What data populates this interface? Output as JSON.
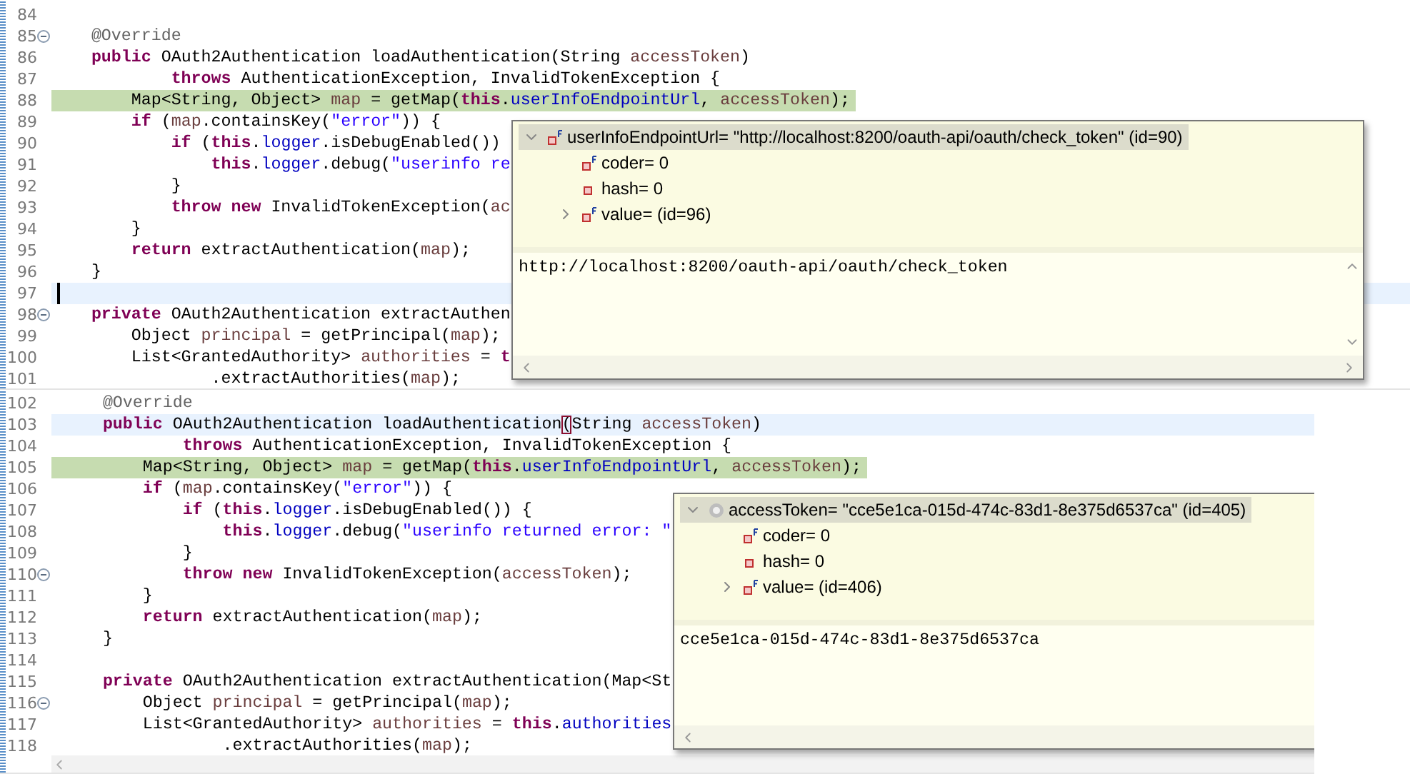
{
  "panels": [
    {
      "lines": [
        {
          "number": "84"
        },
        {
          "number": "85",
          "fold": true,
          "tokens": [
            {
              "text": "    @Override",
              "kind": "annotation"
            }
          ]
        },
        {
          "number": "86",
          "tokens": [
            {
              "text": "    public",
              "kind": "keyword"
            },
            {
              "text": " OAuth2Authentication loadAuthentication(String ",
              "kind": "plain"
            },
            {
              "text": "accessToken",
              "kind": "local"
            },
            {
              "text": ")",
              "kind": "plain"
            }
          ]
        },
        {
          "number": "87",
          "tokens": [
            {
              "text": "            throws",
              "kind": "keyword"
            },
            {
              "text": " AuthenticationException, InvalidTokenException {",
              "kind": "plain"
            }
          ]
        },
        {
          "number": "88",
          "debug_line": true,
          "tokens": [
            {
              "text": "        Map<String, Object> ",
              "kind": "plain"
            },
            {
              "text": "map",
              "kind": "local"
            },
            {
              "text": " = getMap(",
              "kind": "plain"
            },
            {
              "text": "this",
              "kind": "keyword"
            },
            {
              "text": ".",
              "kind": "plain"
            },
            {
              "text": "userInfoEndpointUrl",
              "kind": "field"
            },
            {
              "text": ", ",
              "kind": "plain"
            },
            {
              "text": "accessToken",
              "kind": "local"
            },
            {
              "text": ");",
              "kind": "plain"
            }
          ]
        },
        {
          "number": "89",
          "tokens": [
            {
              "text": "        if",
              "kind": "keyword"
            },
            {
              "text": " (",
              "kind": "plain"
            },
            {
              "text": "map",
              "kind": "local"
            },
            {
              "text": ".containsKey(",
              "kind": "plain"
            },
            {
              "text": "\"error\"",
              "kind": "string"
            },
            {
              "text": ")) {",
              "kind": "plain"
            }
          ]
        },
        {
          "number": "90",
          "tokens": [
            {
              "text": "            if",
              "kind": "keyword"
            },
            {
              "text": " (",
              "kind": "plain"
            },
            {
              "text": "this",
              "kind": "keyword"
            },
            {
              "text": ".",
              "kind": "plain"
            },
            {
              "text": "logger",
              "kind": "field"
            },
            {
              "text": ".isDebugEnabled())",
              "kind": "plain"
            }
          ]
        },
        {
          "number": "91",
          "tokens": [
            {
              "text": "                this",
              "kind": "keyword"
            },
            {
              "text": ".",
              "kind": "plain"
            },
            {
              "text": "logger",
              "kind": "field"
            },
            {
              "text": ".debug(",
              "kind": "plain"
            },
            {
              "text": "\"userinfo re",
              "kind": "string"
            }
          ]
        },
        {
          "number": "92",
          "tokens": [
            {
              "text": "            }",
              "kind": "plain"
            }
          ]
        },
        {
          "number": "93",
          "tokens": [
            {
              "text": "            throw new",
              "kind": "keyword"
            },
            {
              "text": " InvalidTokenException(",
              "kind": "plain"
            },
            {
              "text": "ac",
              "kind": "local"
            }
          ]
        },
        {
          "number": "94",
          "tokens": [
            {
              "text": "        }",
              "kind": "plain"
            }
          ]
        },
        {
          "number": "95",
          "tokens": [
            {
              "text": "        return",
              "kind": "keyword"
            },
            {
              "text": " extractAuthentication(",
              "kind": "plain"
            },
            {
              "text": "map",
              "kind": "local"
            },
            {
              "text": ");",
              "kind": "plain"
            }
          ]
        },
        {
          "number": "96",
          "tokens": [
            {
              "text": "    }",
              "kind": "plain"
            }
          ]
        },
        {
          "number": "97",
          "current_line": true
        },
        {
          "number": "98",
          "fold": true,
          "tokens": [
            {
              "text": "    private",
              "kind": "keyword"
            },
            {
              "text": " OAuth2Authentication extractAuthen",
              "kind": "plain"
            }
          ]
        },
        {
          "number": "99",
          "tokens": [
            {
              "text": "        Object ",
              "kind": "plain"
            },
            {
              "text": "principal",
              "kind": "local"
            },
            {
              "text": " = getPrincipal(",
              "kind": "plain"
            },
            {
              "text": "map",
              "kind": "local"
            },
            {
              "text": ");",
              "kind": "plain"
            }
          ]
        },
        {
          "number": "100",
          "tokens": [
            {
              "text": "        List<GrantedAuthority> ",
              "kind": "plain"
            },
            {
              "text": "authorities",
              "kind": "local"
            },
            {
              "text": " = ",
              "kind": "plain"
            },
            {
              "text": "t",
              "kind": "keyword"
            }
          ]
        },
        {
          "number": "101",
          "tokens": [
            {
              "text": "                .extractAuthorities(",
              "kind": "plain"
            },
            {
              "text": "map",
              "kind": "local"
            },
            {
              "text": ");",
              "kind": "plain"
            }
          ]
        }
      ],
      "popup": {
        "vertical_scrollbar": true,
        "right_scroll_arrow": true,
        "tree": [
          {
            "label": "userInfoEndpointUrl= \"http://localhost:8200/oauth-api/oauth/check_token\" (id=90)",
            "kind": "final-field",
            "expanded": true,
            "selected": true
          },
          {
            "label": "coder= 0",
            "kind": "final-field",
            "selected": false
          },
          {
            "label": "hash= 0",
            "kind": "field",
            "selected": false
          },
          {
            "label": "value= (id=96)",
            "kind": "final-field",
            "expanded": false,
            "selected": false
          }
        ],
        "detail": "http://localhost:8200/oauth-api/oauth/check_token"
      }
    },
    {
      "lines": [
        {
          "number": "102",
          "tokens": [
            {
              "text": "    @Override",
              "kind": "annotation"
            }
          ]
        },
        {
          "number": "103",
          "current_line": true,
          "tokens": [
            {
              "text": "    public",
              "kind": "keyword"
            },
            {
              "text": " OAuth2Authentication loadAuthentication",
              "kind": "plain"
            },
            {
              "text": "(",
              "kind": "bracket"
            },
            {
              "text": "String ",
              "kind": "plain"
            },
            {
              "text": "accessToken",
              "kind": "local"
            },
            {
              "text": ")",
              "kind": "plain"
            }
          ]
        },
        {
          "number": "104",
          "tokens": [
            {
              "text": "            throws",
              "kind": "keyword"
            },
            {
              "text": " AuthenticationException, InvalidTokenException {",
              "kind": "plain"
            }
          ]
        },
        {
          "number": "105",
          "debug_line": true,
          "tokens": [
            {
              "text": "        Map<String, Object> ",
              "kind": "plain"
            },
            {
              "text": "map",
              "kind": "local"
            },
            {
              "text": " = getMap(",
              "kind": "plain"
            },
            {
              "text": "this",
              "kind": "keyword"
            },
            {
              "text": ".",
              "kind": "plain"
            },
            {
              "text": "userInfoEndpointUrl",
              "kind": "field"
            },
            {
              "text": ", ",
              "kind": "plain"
            },
            {
              "text": "accessToken",
              "kind": "local"
            },
            {
              "text": ");",
              "kind": "plain"
            }
          ]
        },
        {
          "number": "106",
          "tokens": [
            {
              "text": "        if",
              "kind": "keyword"
            },
            {
              "text": " (",
              "kind": "plain"
            },
            {
              "text": "map",
              "kind": "local"
            },
            {
              "text": ".containsKey(",
              "kind": "plain"
            },
            {
              "text": "\"error\"",
              "kind": "string"
            },
            {
              "text": ")) {",
              "kind": "plain"
            }
          ]
        },
        {
          "number": "107",
          "tokens": [
            {
              "text": "            if",
              "kind": "keyword"
            },
            {
              "text": " (",
              "kind": "plain"
            },
            {
              "text": "this",
              "kind": "keyword"
            },
            {
              "text": ".",
              "kind": "plain"
            },
            {
              "text": "logger",
              "kind": "field"
            },
            {
              "text": ".isDebugEnabled()) {",
              "kind": "plain"
            }
          ]
        },
        {
          "number": "108",
          "tokens": [
            {
              "text": "                this",
              "kind": "keyword"
            },
            {
              "text": ".",
              "kind": "plain"
            },
            {
              "text": "logger",
              "kind": "field"
            },
            {
              "text": ".debug(",
              "kind": "plain"
            },
            {
              "text": "\"userinfo returned error: \"",
              "kind": "string"
            }
          ]
        },
        {
          "number": "109",
          "tokens": [
            {
              "text": "            }",
              "kind": "plain"
            }
          ]
        },
        {
          "number": "110",
          "fold": true,
          "tokens": [
            {
              "text": "            throw new",
              "kind": "keyword"
            },
            {
              "text": " InvalidTokenException(",
              "kind": "plain"
            },
            {
              "text": "accessToken",
              "kind": "local"
            },
            {
              "text": ");",
              "kind": "plain"
            }
          ]
        },
        {
          "number": "111",
          "tokens": [
            {
              "text": "        }",
              "kind": "plain"
            }
          ]
        },
        {
          "number": "112",
          "tokens": [
            {
              "text": "        return",
              "kind": "keyword"
            },
            {
              "text": " extractAuthentication(",
              "kind": "plain"
            },
            {
              "text": "map",
              "kind": "local"
            },
            {
              "text": ");",
              "kind": "plain"
            }
          ]
        },
        {
          "number": "113",
          "tokens": [
            {
              "text": "    }",
              "kind": "plain"
            }
          ]
        },
        {
          "number": "114"
        },
        {
          "number": "115",
          "tokens": [
            {
              "text": "    private",
              "kind": "keyword"
            },
            {
              "text": " OAuth2Authentication extractAuthentication(Map<St",
              "kind": "plain"
            }
          ]
        },
        {
          "number": "116",
          "fold": true,
          "tokens": [
            {
              "text": "        Object ",
              "kind": "plain"
            },
            {
              "text": "principal",
              "kind": "local"
            },
            {
              "text": " = getPrincipal(",
              "kind": "plain"
            },
            {
              "text": "map",
              "kind": "local"
            },
            {
              "text": ");",
              "kind": "plain"
            }
          ]
        },
        {
          "number": "117",
          "tokens": [
            {
              "text": "        List<GrantedAuthority> ",
              "kind": "plain"
            },
            {
              "text": "authorities",
              "kind": "local"
            },
            {
              "text": " = ",
              "kind": "plain"
            },
            {
              "text": "this",
              "kind": "keyword"
            },
            {
              "text": ".",
              "kind": "plain"
            },
            {
              "text": "authorities",
              "kind": "field"
            }
          ]
        },
        {
          "number": "118",
          "tokens": [
            {
              "text": "                .extractAuthorities(",
              "kind": "plain"
            },
            {
              "text": "map",
              "kind": "local"
            },
            {
              "text": ");",
              "kind": "plain"
            }
          ]
        }
      ],
      "popup": {
        "vertical_scrollbar": false,
        "right_scroll_arrow": false,
        "tree": [
          {
            "label": "accessToken= \"cce5e1ca-015d-474c-83d1-8e375d6537ca\" (id=405)",
            "kind": "local",
            "expanded": true,
            "selected": true
          },
          {
            "label": "coder= 0",
            "kind": "final-field",
            "selected": false
          },
          {
            "label": "hash= 0",
            "kind": "field",
            "selected": false
          },
          {
            "label": "value= (id=406)",
            "kind": "final-field",
            "expanded": false,
            "selected": false
          }
        ],
        "detail": "cce5e1ca-015d-474c-83d1-8e375d6537ca"
      }
    }
  ]
}
